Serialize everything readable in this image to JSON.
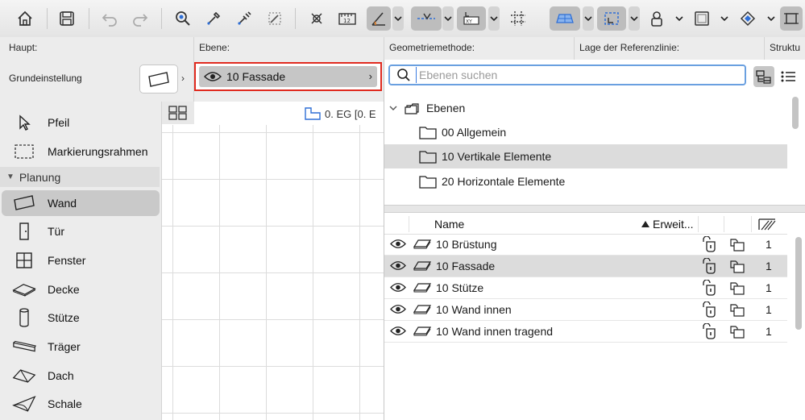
{
  "infobox": {
    "headers": {
      "haupt": "Haupt:",
      "ebene": "Ebene:",
      "geometrie": "Geometriemethode:",
      "lage": "Lage der Referenzlinie:",
      "struktur": "Struktu"
    },
    "grundeinstellung": "Grundeinstellung",
    "layer_selector": {
      "label": "10 Fassade"
    }
  },
  "toolbox": {
    "tools_top": [
      {
        "label": "Pfeil",
        "icon": "arrow-pointer-icon"
      },
      {
        "label": "Markierungsrahmen",
        "icon": "marquee-icon"
      }
    ],
    "group": {
      "label": "Planung",
      "expanded": true
    },
    "tools": [
      {
        "label": "Wand",
        "icon": "wall-icon",
        "selected": true
      },
      {
        "label": "Tür",
        "icon": "door-icon"
      },
      {
        "label": "Fenster",
        "icon": "window-icon"
      },
      {
        "label": "Decke",
        "icon": "slab-icon"
      },
      {
        "label": "Stütze",
        "icon": "column-icon"
      },
      {
        "label": "Träger",
        "icon": "beam-icon"
      },
      {
        "label": "Dach",
        "icon": "roof-icon"
      },
      {
        "label": "Schale",
        "icon": "shell-icon"
      }
    ]
  },
  "canvas": {
    "story_label": "0. EG [0. E"
  },
  "layer_panel": {
    "search": {
      "placeholder": "Ebenen suchen",
      "value": ""
    },
    "tree": [
      {
        "label": "Ebenen",
        "level": 0,
        "expanded": true,
        "icon": "layer-folders-icon"
      },
      {
        "label": "00 Allgemein",
        "level": 1,
        "icon": "folder-icon"
      },
      {
        "label": "10 Vertikale Elemente",
        "level": 1,
        "icon": "folder-icon",
        "selected": true
      },
      {
        "label": "20 Horizontale Elemente",
        "level": 1,
        "icon": "folder-icon"
      }
    ],
    "columns": {
      "name": "Name",
      "erweit": "Erweit..."
    },
    "layers": [
      {
        "name": "10 Brüstung",
        "num": "1"
      },
      {
        "name": "10 Fassade",
        "num": "1",
        "selected": true
      },
      {
        "name": "10 Stütze",
        "num": "1"
      },
      {
        "name": "10 Wand innen",
        "num": "1"
      },
      {
        "name": "10 Wand innen tragend",
        "num": "1"
      }
    ]
  },
  "colors": {
    "highlight_border": "#e02b20",
    "search_focus": "#6aa0e0",
    "selected_row": "#dcdcdc"
  }
}
